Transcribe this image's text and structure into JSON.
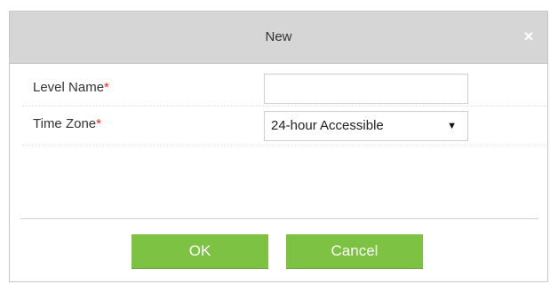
{
  "dialog": {
    "title": "New",
    "close_label": "×"
  },
  "form": {
    "level_name": {
      "label": "Level Name",
      "required_mark": "*",
      "value": ""
    },
    "time_zone": {
      "label": "Time Zone",
      "required_mark": "*",
      "selected": "24-hour Accessible",
      "arrow": "▼"
    }
  },
  "buttons": {
    "ok": "OK",
    "cancel": "Cancel"
  },
  "colors": {
    "accent": "#7dc242",
    "titlebar": "#d6d6d6",
    "required": "#e12b2b"
  }
}
